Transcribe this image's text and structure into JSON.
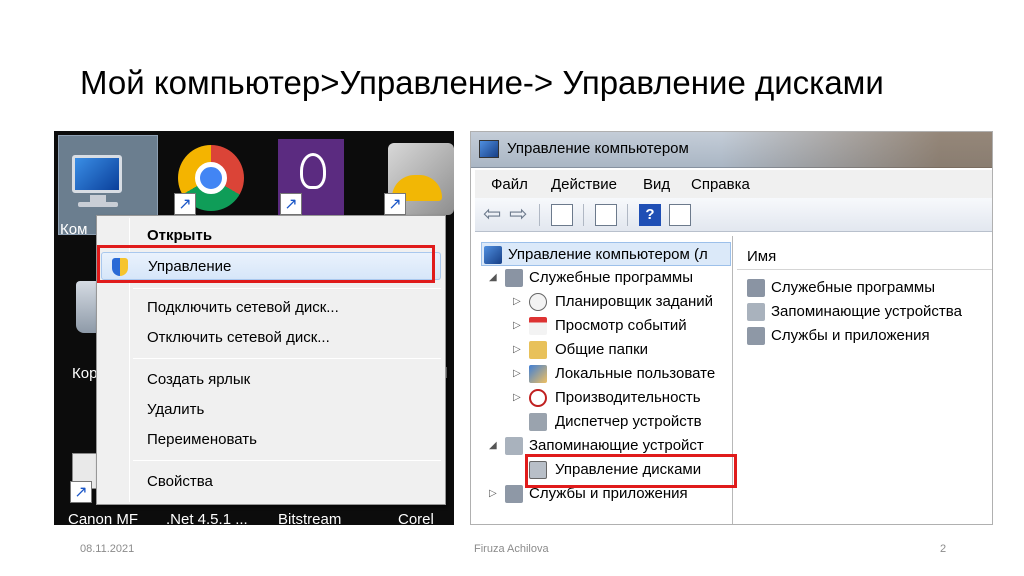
{
  "slide": {
    "title": "Мой компьютер>Управление-> Управление дисками",
    "footer_date": "08.11.2021",
    "footer_author": "Firuza Achilova",
    "footer_page": "2"
  },
  "desktop": {
    "labels": {
      "computer_partial": "Ком",
      "recycle_partial": "Кор",
      "right_partial": "id",
      "canon": "Canon MF",
      "net": ".Net 4.5.1 ...",
      "bitstream": "Bitstream",
      "corel": "Corel"
    },
    "context_menu": {
      "items": [
        {
          "label": "Открыть"
        },
        {
          "label": "Управление"
        },
        {
          "label": "Подключить сетевой диск..."
        },
        {
          "label": "Отключить сетевой диск..."
        },
        {
          "label": "Создать ярлык"
        },
        {
          "label": "Удалить"
        },
        {
          "label": "Переименовать"
        },
        {
          "label": "Свойства"
        }
      ]
    }
  },
  "computer_management": {
    "window_title": "Управление компьютером",
    "menu": [
      "Файл",
      "Действие",
      "Вид",
      "Справка"
    ],
    "help_glyph": "?",
    "tree": {
      "root": "Управление компьютером (л",
      "system_tools": "Служебные программы",
      "task_scheduler": "Планировщик заданий",
      "event_viewer": "Просмотр событий",
      "shared_folders": "Общие папки",
      "local_users": "Локальные пользовате",
      "performance": "Производительность",
      "device_manager": "Диспетчер устройств",
      "storage": "Запоминающие устройст",
      "disk_management": "Управление дисками",
      "services": "Службы и приложения"
    },
    "list": {
      "column_name": "Имя",
      "items": [
        "Служебные программы",
        "Запоминающие устройства",
        "Службы и приложения"
      ]
    }
  }
}
